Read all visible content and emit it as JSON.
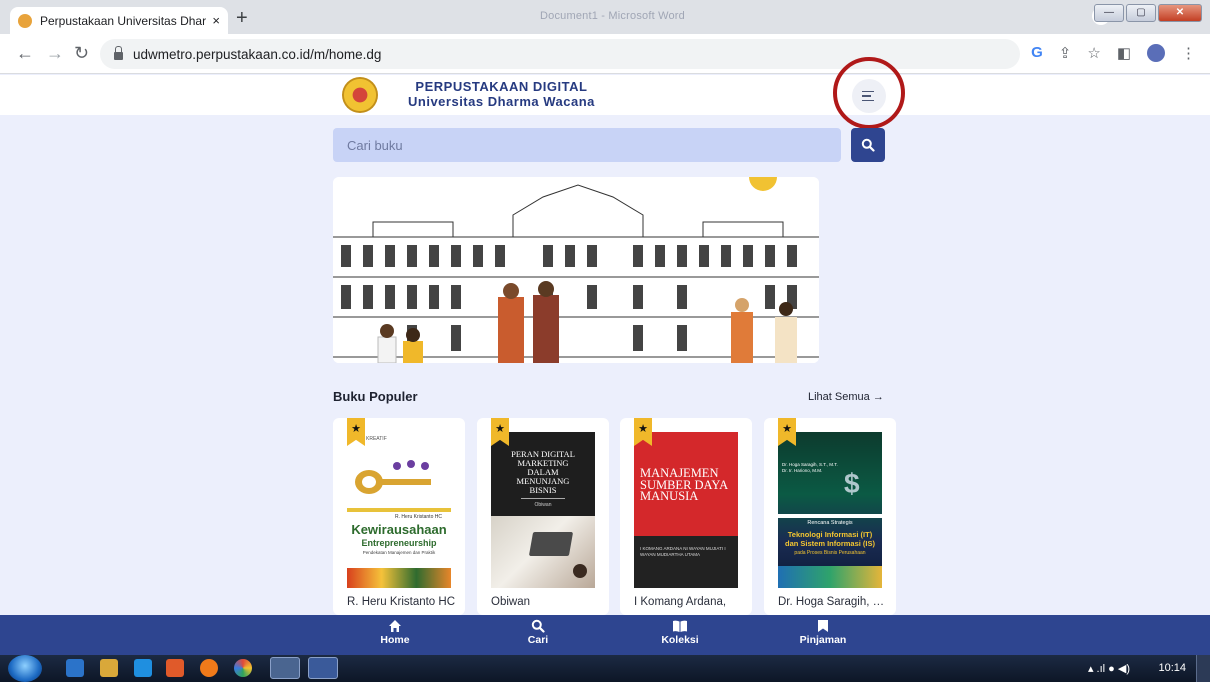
{
  "browser": {
    "tab_title": "Perpustakaan Universitas Dharma",
    "tab_close": "×",
    "new_tab": "+",
    "window_title": "Document1 - Microsoft Word",
    "url": "udwmetro.perpustakaan.co.id/m/home.dg"
  },
  "app": {
    "brand_line1": "PERPUSTAKAAN DIGITAL",
    "brand_line2": "Universitas Dharma Wacana",
    "search_placeholder": "Cari buku",
    "popular_title": "Buku Populer",
    "see_all": "Lihat Semua →",
    "books": [
      {
        "author": "R. Heru Kristanto HC",
        "cover_top": "ANDA KREATIF",
        "cover_small": "R. Heru Kristanto HC",
        "cover_title": "Kewirausahaan",
        "cover_sub": "Entrepreneurship",
        "cover_tagline": "Pendekatan Manajemen dan Praktik"
      },
      {
        "author": "Obiwan",
        "cover_title": "PERAN DIGITAL MARKETING DALAM MENUNJANG BISNIS",
        "cover_small": "Obiwan"
      },
      {
        "author": "I Komang Ardana,",
        "cover_title": "MANAJEMEN SUMBER DAYA MANUSIA",
        "cover_small": "I KOMANG ARDANA NI WAYAN MUJIATI I WAYAN MUDIARTHA UTAMA"
      },
      {
        "author": "Dr. Hoga Saragih, S...",
        "cover_small": "Dr. Hoga Saragih, S.T., M.T. Dr. Ir. Hariono, M.M.",
        "cover_kicker": "Rencana Strategis",
        "cover_title": "Teknologi Informasi (IT) dan Sistem Informasi (IS)",
        "cover_sub": "pada Proses Bisnis Perusahaan"
      }
    ]
  },
  "bottom_nav": [
    {
      "label": "Home",
      "icon": "home-icon"
    },
    {
      "label": "Cari",
      "icon": "search-icon"
    },
    {
      "label": "Koleksi",
      "icon": "book-open-icon"
    },
    {
      "label": "Pinjaman",
      "icon": "bookmark-icon"
    }
  ],
  "taskbar": {
    "clock": "10:14"
  },
  "colors": {
    "primary": "#2e4590",
    "page_bg": "#eceffc",
    "annotation": "#b01919",
    "ribbon": "#f0b82a"
  }
}
